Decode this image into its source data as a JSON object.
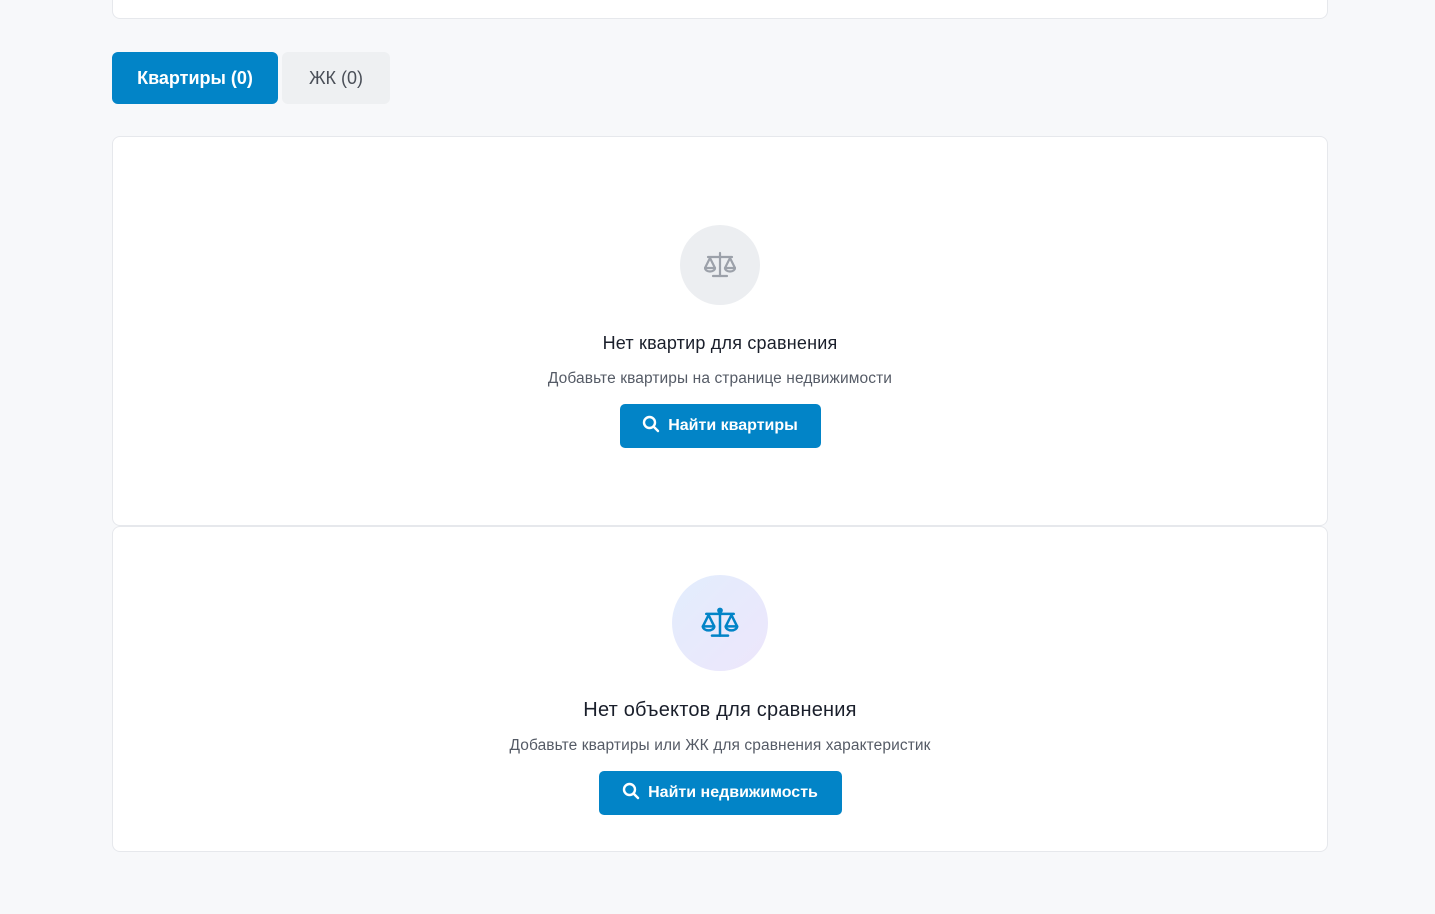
{
  "tabs": [
    {
      "label": "Квартиры (0)",
      "active": true
    },
    {
      "label": "ЖК (0)",
      "active": false
    }
  ],
  "apartments_empty": {
    "icon": "scale-icon",
    "title": "Нет квартир для сравнения",
    "subtitle": "Добавьте квартиры на странице недвижимости",
    "button_label": "Найти квартиры",
    "button_icon": "search-icon"
  },
  "objects_empty": {
    "icon": "scale-icon",
    "title": "Нет объектов для сравнения",
    "subtitle": "Добавьте квартиры или ЖК для сравнения характеристик",
    "button_label": "Найти недвижимость",
    "button_icon": "search-icon"
  },
  "colors": {
    "accent": "#0284c7",
    "page_bg": "#f7f8fa",
    "card_bg": "#ffffff",
    "icon_gray": "#9ca1aa"
  }
}
